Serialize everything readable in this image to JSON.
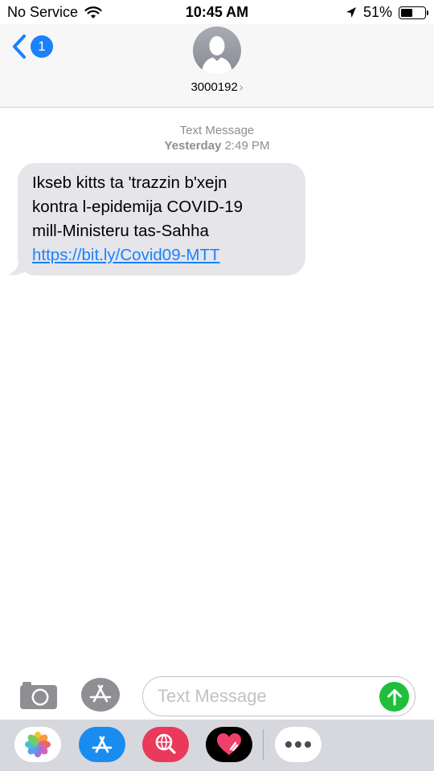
{
  "status_bar": {
    "carrier": "No Service",
    "time": "10:45 AM",
    "battery_percent": "51%",
    "battery_level": 0.51,
    "icons": [
      "wifi-icon",
      "location-arrow-icon",
      "battery-icon"
    ]
  },
  "header": {
    "unread_count": "1",
    "contact": "3000192",
    "icons": [
      "back-chevron-icon",
      "avatar-silhouette-icon",
      "chevron-right-icon"
    ]
  },
  "conversation": {
    "service_label": "Text Message",
    "day": "Yesterday",
    "time": "2:49 PM",
    "message": {
      "lines": [
        "Ikseb kitts ta 'trazzin b'xejn",
        "kontra l-epidemija COVID-19",
        "mill-Ministeru tas-Sahha"
      ],
      "link": "https://bit.ly/Covid09-MTT"
    }
  },
  "composer": {
    "placeholder": "Text Message",
    "value": "",
    "icons": [
      "camera-icon",
      "app-store-icon",
      "send-arrow-icon"
    ]
  },
  "app_drawer": {
    "apps": [
      "photos-app-icon",
      "app-store-app-icon",
      "web-search-app-icon",
      "digital-touch-app-icon",
      "more-apps-icon"
    ]
  },
  "colors": {
    "accent_blue": "#1a82fb",
    "bubble_gray": "#e5e5ea",
    "send_green": "#1fbf3c",
    "header_bg": "#f7f7f7",
    "drawer_bg": "#d6d8de",
    "meta_gray": "#8e8e93"
  }
}
